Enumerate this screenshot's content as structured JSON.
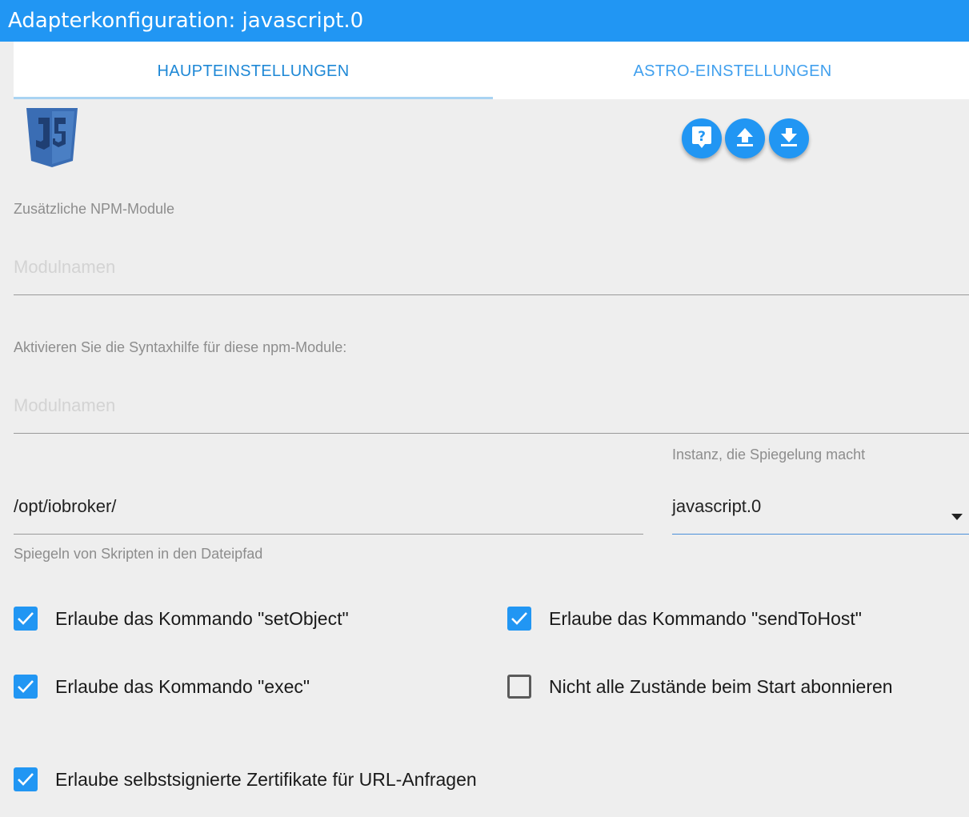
{
  "window": {
    "title": "Adapterkonfiguration: javascript.0"
  },
  "tabs": [
    {
      "label": "HAUPTEINSTELLUNGEN",
      "active": true
    },
    {
      "label": "ASTRO-EINSTELLUNGEN",
      "active": false
    }
  ],
  "logo": {
    "text": "JS"
  },
  "toolbar": {
    "help_icon": "help-icon",
    "upload_icon": "upload-icon",
    "download_icon": "download-icon"
  },
  "npm": {
    "label": "Zusätzliche NPM-Module",
    "placeholder": "Modulnamen"
  },
  "syntax": {
    "label": "Aktivieren Sie die Syntaxhilfe für diese npm-Module:",
    "placeholder": "Modulnamen"
  },
  "mirror": {
    "path_value": "/opt/iobroker/",
    "path_helper": "Spiegeln von Skripten in den Dateipfad",
    "instance_label": "Instanz, die Spiegelung macht",
    "instance_value": "javascript.0"
  },
  "checkboxes": {
    "setobject": {
      "label": "Erlaube das Kommando \"setObject\"",
      "checked": true
    },
    "sendtohost": {
      "label": "Erlaube das Kommando \"sendToHost\"",
      "checked": true
    },
    "exec": {
      "label": "Erlaube das Kommando \"exec\"",
      "checked": true
    },
    "nosubscribe": {
      "label": "Nicht alle Zustände beim Start abonnieren",
      "checked": false
    },
    "selfsigned": {
      "label": "Erlaube selbstsignierte Zertifikate für URL-Anfragen",
      "checked": true
    }
  },
  "colors": {
    "accent": "#2196f3",
    "background": "#eeeeee",
    "logo": "#3a6db4"
  }
}
